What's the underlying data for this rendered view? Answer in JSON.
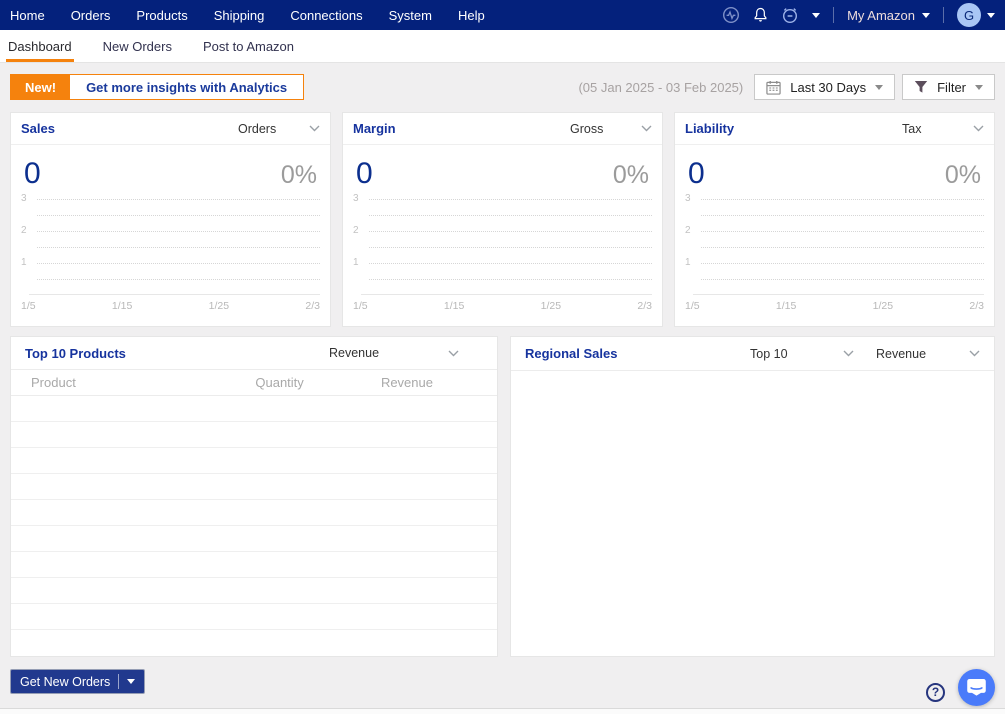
{
  "colors": {
    "nav_bg": "#04217c",
    "accent_orange": "#f5820d",
    "title_navy": "#16339e",
    "value_navy": "#0c2f8e",
    "muted_gray": "#9b9b9b",
    "button_navy": "#21398e",
    "chat_blue": "#4a7bfa"
  },
  "nav": {
    "items": [
      "Home",
      "Orders",
      "Products",
      "Shipping",
      "Connections",
      "System",
      "Help"
    ],
    "icons": [
      "activity-icon",
      "notifications-bell-icon",
      "snooze-alarm-icon"
    ],
    "account_label": "My Amazon",
    "avatar_initial": "G"
  },
  "tabs": [
    {
      "label": "Dashboard",
      "active": true
    },
    {
      "label": "New Orders",
      "active": false
    },
    {
      "label": "Post to Amazon",
      "active": false
    }
  ],
  "banner": {
    "badge": "New!",
    "label": "Get more insights with Analytics"
  },
  "toolbar": {
    "date_range": "(05 Jan 2025 - 03 Feb 2025)",
    "date_preset": "Last 30 Days",
    "filter_label": "Filter"
  },
  "kpi_cards": [
    {
      "title": "Sales",
      "dropdown": "Orders",
      "value": "0",
      "percent": "0%"
    },
    {
      "title": "Margin",
      "dropdown": "Gross",
      "value": "0",
      "percent": "0%"
    },
    {
      "title": "Liability",
      "dropdown": "Tax",
      "value": "0",
      "percent": "0%"
    }
  ],
  "chart_data": {
    "type": "line",
    "title": "KPI sparkline axes (identical on Sales, Margin and Liability cards; no data plotted)",
    "x_ticks": [
      "1/5",
      "1/15",
      "1/25",
      "2/3"
    ],
    "y_ticks": [
      3,
      2,
      1
    ],
    "y_gridlines": [
      3,
      2.5,
      2,
      1.5,
      1,
      0.5
    ],
    "ylim": [
      0,
      3.5
    ],
    "series": [],
    "grid": "horizontal-dotted",
    "legend": "none",
    "note": "All KPI values are 0 / 0% for the period 05 Jan 2025 - 03 Feb 2025"
  },
  "products_card": {
    "title": "Top 10 Products",
    "dropdown": "Revenue",
    "columns": [
      "Product",
      "Quantity",
      "Revenue"
    ],
    "rows": [],
    "visible_empty_rows": 10
  },
  "regional_card": {
    "title": "Regional Sales",
    "dropdown_count": "Top 10",
    "dropdown_metric": "Revenue"
  },
  "footer": {
    "button_label": "Get New Orders",
    "help_label": "?"
  }
}
